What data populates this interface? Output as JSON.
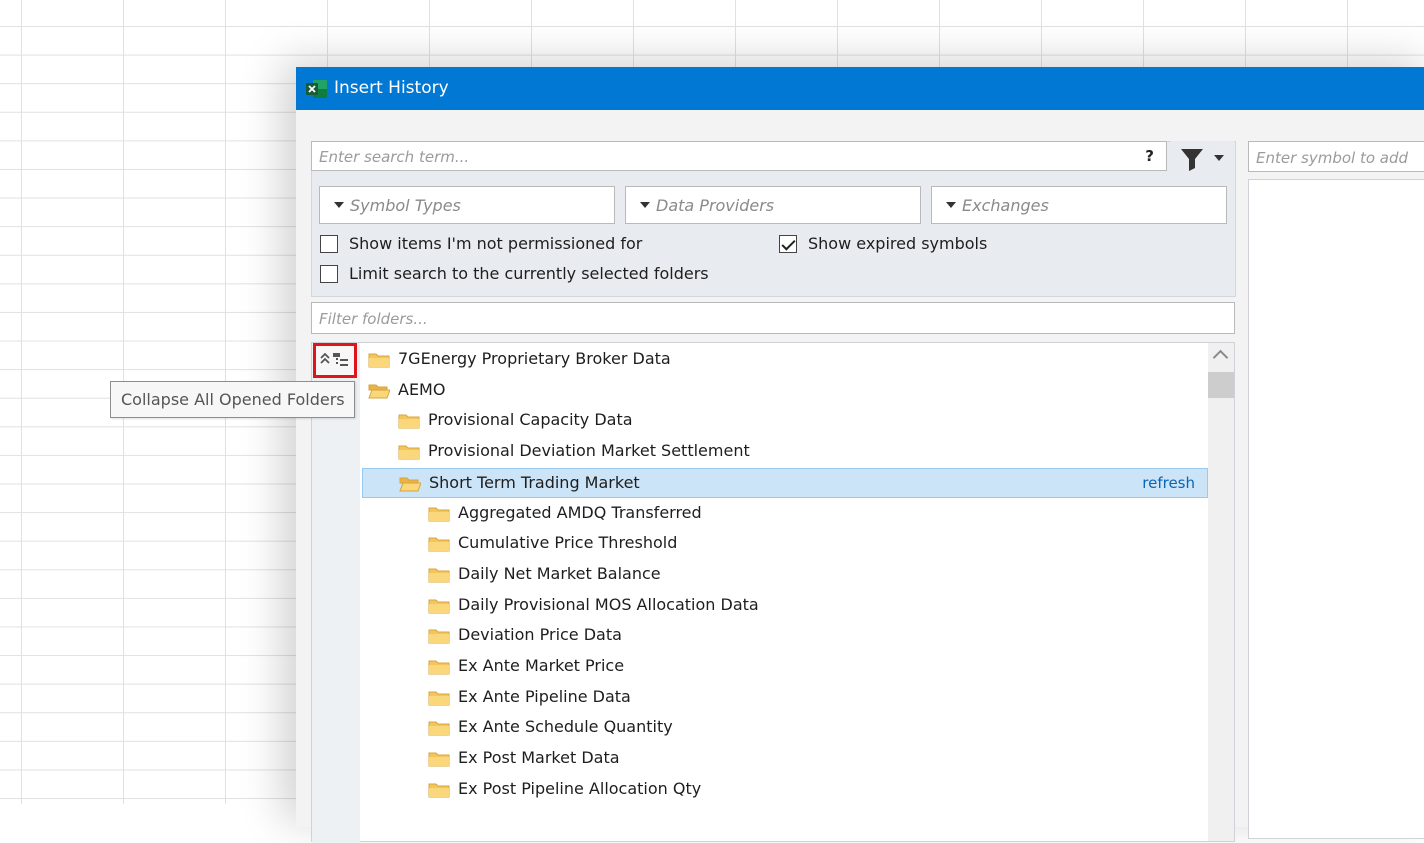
{
  "dialog": {
    "title": "Insert History"
  },
  "search": {
    "placeholder": "Enter search term...",
    "help_label": "?"
  },
  "filters": {
    "dropdowns": [
      {
        "label": "Symbol Types"
      },
      {
        "label": "Data Providers"
      },
      {
        "label": "Exchanges"
      }
    ],
    "checkboxes": [
      {
        "label": "Show items I'm not permissioned for",
        "checked": false
      },
      {
        "label": "Limit search to the currently selected folders",
        "checked": false
      },
      {
        "label": "Show expired symbols",
        "checked": true
      }
    ]
  },
  "folder_filter": {
    "placeholder": "Filter folders..."
  },
  "symbol_panel": {
    "placeholder": "Enter symbol to add"
  },
  "tooltip": {
    "text": "Collapse All Opened Folders"
  },
  "tree": {
    "refresh_label": "refresh",
    "items": [
      {
        "label": "7GEnergy Proprietary Broker Data",
        "level": 0,
        "open": false
      },
      {
        "label": "AEMO",
        "level": 0,
        "open": true
      },
      {
        "label": "Provisional Capacity Data",
        "level": 1,
        "open": false
      },
      {
        "label": "Provisional Deviation Market Settlement",
        "level": 1,
        "open": false
      },
      {
        "label": "Short Term Trading Market",
        "level": 1,
        "open": true,
        "selected": true
      },
      {
        "label": "Aggregated AMDQ Transferred",
        "level": 2,
        "open": false
      },
      {
        "label": "Cumulative Price Threshold",
        "level": 2,
        "open": false
      },
      {
        "label": "Daily Net Market Balance",
        "level": 2,
        "open": false
      },
      {
        "label": "Daily Provisional MOS Allocation Data",
        "level": 2,
        "open": false
      },
      {
        "label": "Deviation Price Data",
        "level": 2,
        "open": false
      },
      {
        "label": "Ex Ante Market Price",
        "level": 2,
        "open": false
      },
      {
        "label": "Ex Ante Pipeline Data",
        "level": 2,
        "open": false
      },
      {
        "label": "Ex Ante Schedule Quantity",
        "level": 2,
        "open": false
      },
      {
        "label": "Ex Post Market Data",
        "level": 2,
        "open": false
      },
      {
        "label": "Ex Post Pipeline Allocation Qty",
        "level": 2,
        "open": false
      }
    ]
  },
  "colors": {
    "titlebar": "#0078d4",
    "selection": "#cce4f7",
    "folder": "#f4c55c",
    "highlight_border": "#e0141b",
    "link": "#0a64b4"
  },
  "icons": {
    "app": "excel-icon",
    "filter": "funnel-icon",
    "collapse": "collapse-all-icon",
    "folder": "folder-icon",
    "folder_open": "folder-open-icon"
  }
}
